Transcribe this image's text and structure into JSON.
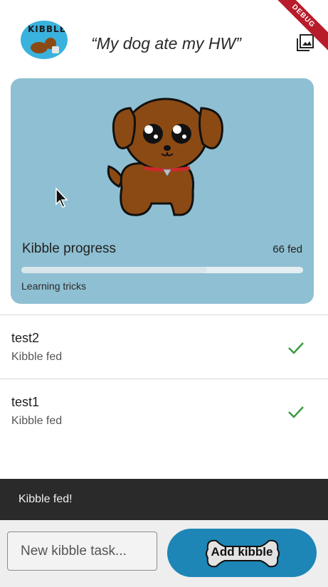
{
  "appbar": {
    "logo_text": "KIBBLE",
    "title": "“My dog ate my HW”",
    "gallery_icon": "photo-library-icon",
    "debug_banner": "DEBUG"
  },
  "card": {
    "progress_label": "Kibble progress",
    "fed_count": "66 fed",
    "progress": 0.66,
    "subtitle": "Learning tricks",
    "background": "#8fbfd2"
  },
  "tasks": [
    {
      "title": "test2",
      "subtitle": "Kibble fed",
      "status_icon": "check-icon"
    },
    {
      "title": "test1",
      "subtitle": "Kibble fed",
      "status_icon": "check-icon"
    }
  ],
  "snackbar": {
    "text": "Kibble fed!"
  },
  "composer": {
    "placeholder": "New kibble task...",
    "add_label": "Add kibble",
    "accent": "#1d86b7"
  }
}
